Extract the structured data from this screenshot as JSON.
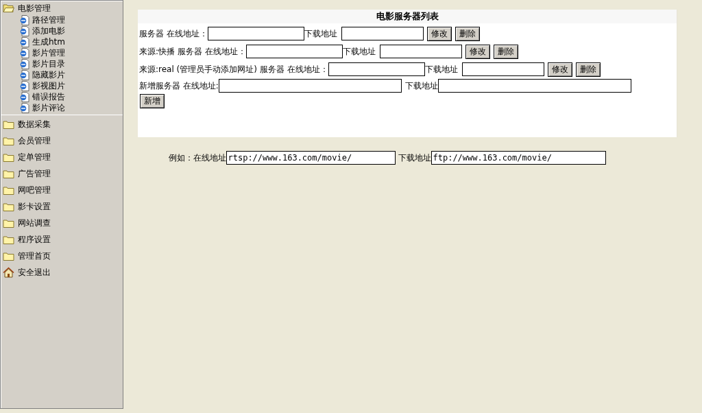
{
  "sidebar": {
    "items": [
      {
        "kind": "folder",
        "label": "电影管理",
        "expanded": true,
        "children": [
          {
            "label": "路径管理"
          },
          {
            "label": "添加电影"
          },
          {
            "label": "生成htm"
          },
          {
            "label": "影片管理"
          },
          {
            "label": "影片目录"
          },
          {
            "label": "隐藏影片"
          },
          {
            "label": "影视图片"
          },
          {
            "label": "错误报告"
          },
          {
            "label": "影片评论"
          }
        ]
      },
      {
        "kind": "folder",
        "label": "数据采集",
        "expanded": false
      },
      {
        "kind": "folder",
        "label": "会员管理",
        "expanded": false
      },
      {
        "kind": "folder",
        "label": "定单管理",
        "expanded": false
      },
      {
        "kind": "folder",
        "label": "广告管理",
        "expanded": false
      },
      {
        "kind": "folder",
        "label": "网吧管理",
        "expanded": false
      },
      {
        "kind": "folder",
        "label": "影卡设置",
        "expanded": false
      },
      {
        "kind": "folder",
        "label": "网站调查",
        "expanded": false
      },
      {
        "kind": "folder",
        "label": "程序设置",
        "expanded": false
      },
      {
        "kind": "folder",
        "label": "管理首页",
        "expanded": false
      },
      {
        "kind": "home",
        "label": "安全退出"
      }
    ]
  },
  "panel": {
    "title": "电影服务器列表",
    "rows": [
      {
        "kind": "server",
        "label": "服务器 在线地址：",
        "download_label": "下载地址",
        "buttons": [
          "修改",
          "删除"
        ]
      },
      {
        "kind": "server",
        "label": "来源:快播 服务器 在线地址：",
        "download_label": "下载地址",
        "buttons": [
          "修改",
          "删除"
        ]
      },
      {
        "kind": "server",
        "label": "来源:real (管理员手动添加网址) 服务器 在线地址：",
        "download_label": "下载地址",
        "buttons": [
          "修改",
          "删除"
        ]
      },
      {
        "kind": "new",
        "label": "新增服务器 在线地址:",
        "download_label": "下载地址",
        "buttons": [
          "新增"
        ]
      }
    ]
  },
  "example": {
    "label": "例如：在线地址",
    "online_value": "rtsp://www.163.com/movie/",
    "download_label": "下载地址",
    "download_value": "ftp://www.163.com/movie/"
  }
}
